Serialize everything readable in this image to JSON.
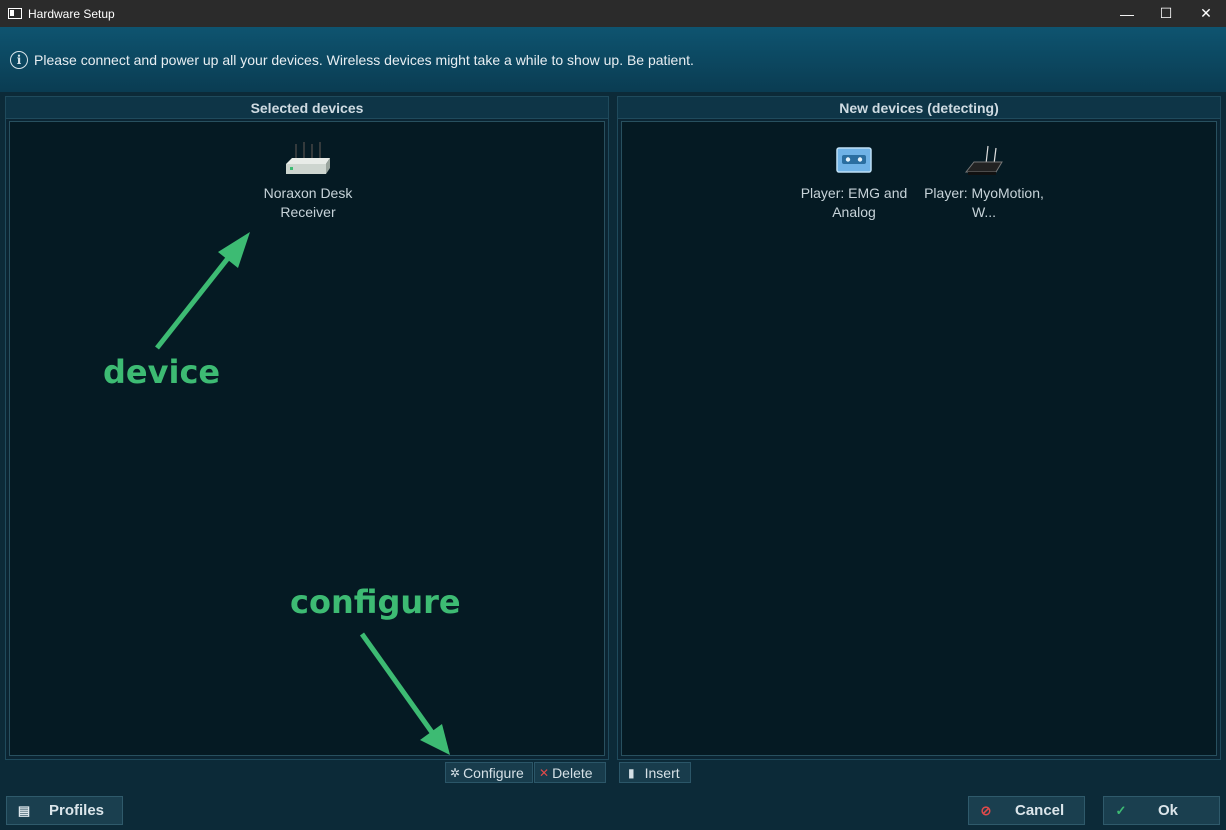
{
  "window": {
    "title": "Hardware Setup",
    "controls": {
      "minimize": "—",
      "maximize": "☐",
      "close": "✕"
    }
  },
  "banner": {
    "icon": "info-icon",
    "message": "Please connect and power up all your devices. Wireless devices might take a while to show up. Be patient."
  },
  "selected_panel": {
    "header": "Selected devices",
    "devices": [
      {
        "label": "Noraxon Desk Receiver",
        "icon": "desk-receiver-icon"
      }
    ],
    "actions": {
      "configure": "Configure",
      "delete": "Delete"
    }
  },
  "new_panel": {
    "header": "New devices (detecting)",
    "devices": [
      {
        "label": "Player: EMG and Analog",
        "icon": "emg-player-icon"
      },
      {
        "label": "Player: MyoMotion, W...",
        "icon": "myomotion-player-icon"
      }
    ],
    "actions": {
      "insert": "Insert"
    }
  },
  "footer": {
    "profiles": "Profiles",
    "cancel": "Cancel",
    "ok": "Ok"
  },
  "annotations": {
    "device": "device",
    "configure": "configure",
    "color": "#3dbb73"
  }
}
